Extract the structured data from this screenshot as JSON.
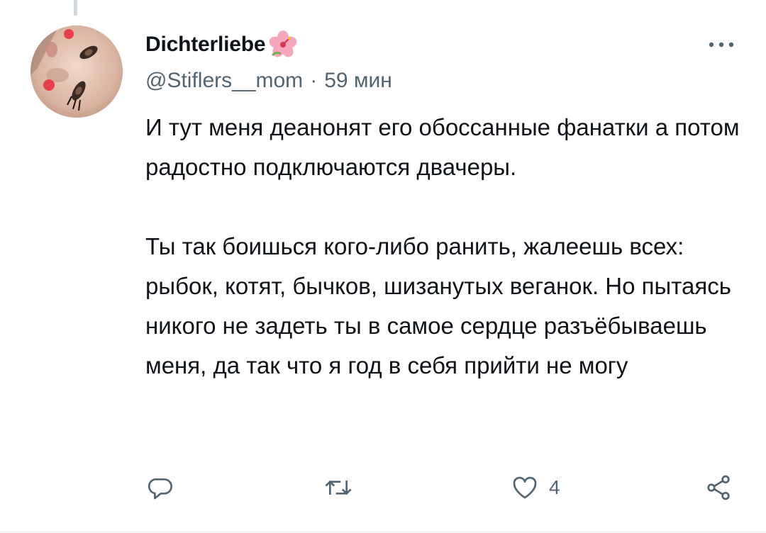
{
  "tweet": {
    "author": {
      "display_name": "Dichterliebe",
      "handle": "@Stiflers__mom",
      "avatar_icon": "avatar-photo",
      "name_emoji_icon": "hibiscus-flower-icon"
    },
    "separator": "·",
    "time_ago": "59 мин",
    "text_paragraphs": [
      "И тут меня деанонят его обоссанные фанатки а потом радостно подключаются двачеры.",
      "Ты так боишься кого-либо ранить, жалеешь всех: рыбок, котят, бычков, шизанутых веганок. Но пытаясь никого не задеть ты в самое сердце разъёбываешь меня, да так что я год в себя прийти не могу"
    ],
    "actions": {
      "reply_icon": "reply-icon",
      "retweet_icon": "retweet-icon",
      "like_icon": "heart-icon",
      "like_count": "4",
      "share_icon": "share-icon"
    },
    "more_icon": "more-dots-icon"
  },
  "colors": {
    "text_primary": "#0f1419",
    "text_secondary": "#536471",
    "divider": "#eff3f4"
  }
}
